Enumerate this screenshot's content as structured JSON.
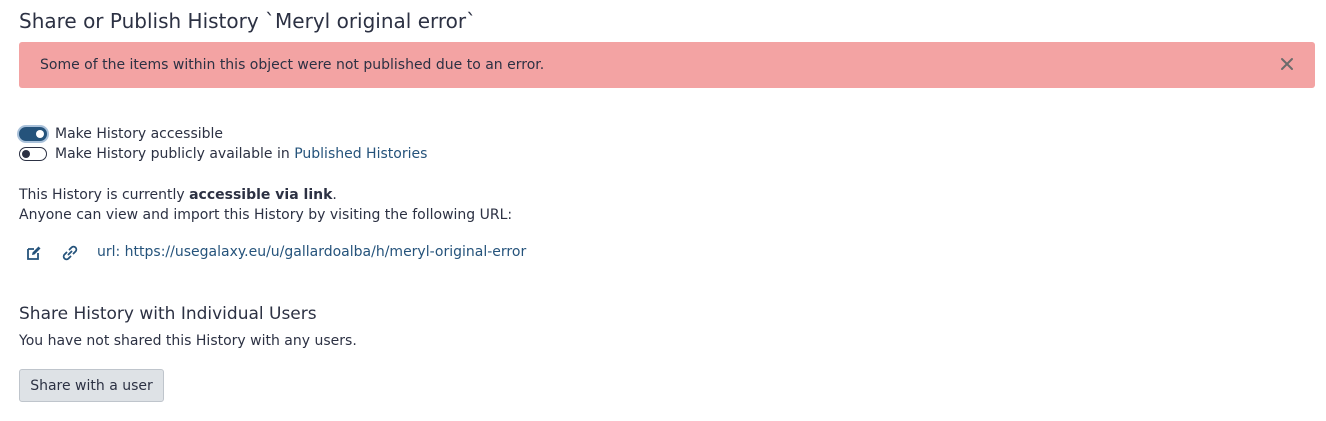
{
  "title": "Share or Publish History `Meryl original error`",
  "alert": {
    "message": "Some of the items within this object were not published due to an error.",
    "close_icon": "close-icon",
    "color": "#f3a3a3"
  },
  "toggles": [
    {
      "label": "Make History accessible",
      "checked": true
    },
    {
      "label_prefix": "Make History publicly available in",
      "link_text": "Published Histories",
      "checked": false
    }
  ],
  "status": {
    "prefix": "This History is currently",
    "emphasis": "accessible via link",
    "suffix": ".",
    "url_note": "Anyone can view and import this History by visiting the following URL:"
  },
  "url_row": {
    "edit_icon": "edit-icon",
    "copy_icon": "link-icon",
    "url": "url: https://usegalaxy.eu/u/gallardoalba/h/meryl-original-error"
  },
  "share_users": {
    "heading": "Share History with Individual Users",
    "empty_note": "You have not shared this History with any users.",
    "button_label": "Share with a user"
  },
  "colors": {
    "accent": "#25537b",
    "text": "#2c3143"
  }
}
